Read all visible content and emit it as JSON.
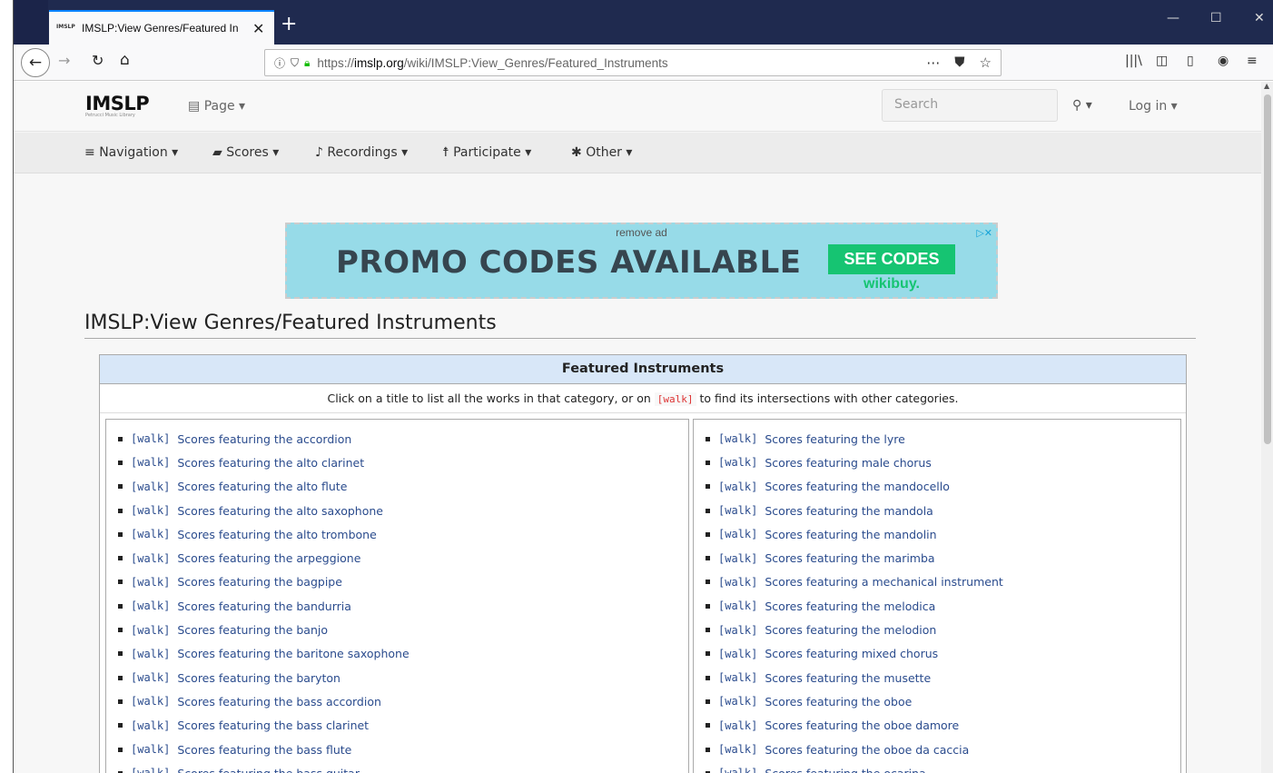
{
  "browser": {
    "tab_favicon": "IMSLP",
    "tab_title": "IMSLP:View Genres/Featured In",
    "tab_close": "✕",
    "new_tab": "+",
    "url_prefix": "https://",
    "url_domain": "imslp.org",
    "url_path": "/wiki/IMSLP:View_Genres/Featured_Instruments"
  },
  "site": {
    "logo": "IMSLP",
    "logo_sub": "Petrucci Music Library",
    "page_menu": "Page",
    "search_placeholder": "Search",
    "login": "Log in"
  },
  "menu": {
    "navigation": "Navigation",
    "scores": "Scores",
    "recordings": "Recordings",
    "participate": "Participate",
    "other": "Other"
  },
  "ad": {
    "remove": "remove ad",
    "headline": "PROMO CODES AVAILABLE",
    "cta": "SEE CODES",
    "brand": "wikibuy."
  },
  "page_title": "IMSLP:View Genres/Featured Instruments",
  "table": {
    "header": "Featured Instruments",
    "intro_before": "Click on a title to list all the works in that category, or on",
    "intro_walk": "[walk]",
    "intro_after": "to find its intersections with other categories.",
    "walk_label": "[walk]",
    "left_items": [
      "Scores featuring the accordion",
      "Scores featuring the alto clarinet",
      "Scores featuring the alto flute",
      "Scores featuring the alto saxophone",
      "Scores featuring the alto trombone",
      "Scores featuring the arpeggione",
      "Scores featuring the bagpipe",
      "Scores featuring the bandurria",
      "Scores featuring the banjo",
      "Scores featuring the baritone saxophone",
      "Scores featuring the baryton",
      "Scores featuring the bass accordion",
      "Scores featuring the bass clarinet",
      "Scores featuring the bass flute",
      "Scores featuring the bass guitar"
    ],
    "right_items": [
      "Scores featuring the lyre",
      "Scores featuring male chorus",
      "Scores featuring the mandocello",
      "Scores featuring the mandola",
      "Scores featuring the mandolin",
      "Scores featuring the marimba",
      "Scores featuring a mechanical instrument",
      "Scores featuring the melodica",
      "Scores featuring the melodion",
      "Scores featuring mixed chorus",
      "Scores featuring the musette",
      "Scores featuring the oboe",
      "Scores featuring the oboe damore",
      "Scores featuring the oboe da caccia",
      "Scores featuring the ocarina"
    ]
  }
}
